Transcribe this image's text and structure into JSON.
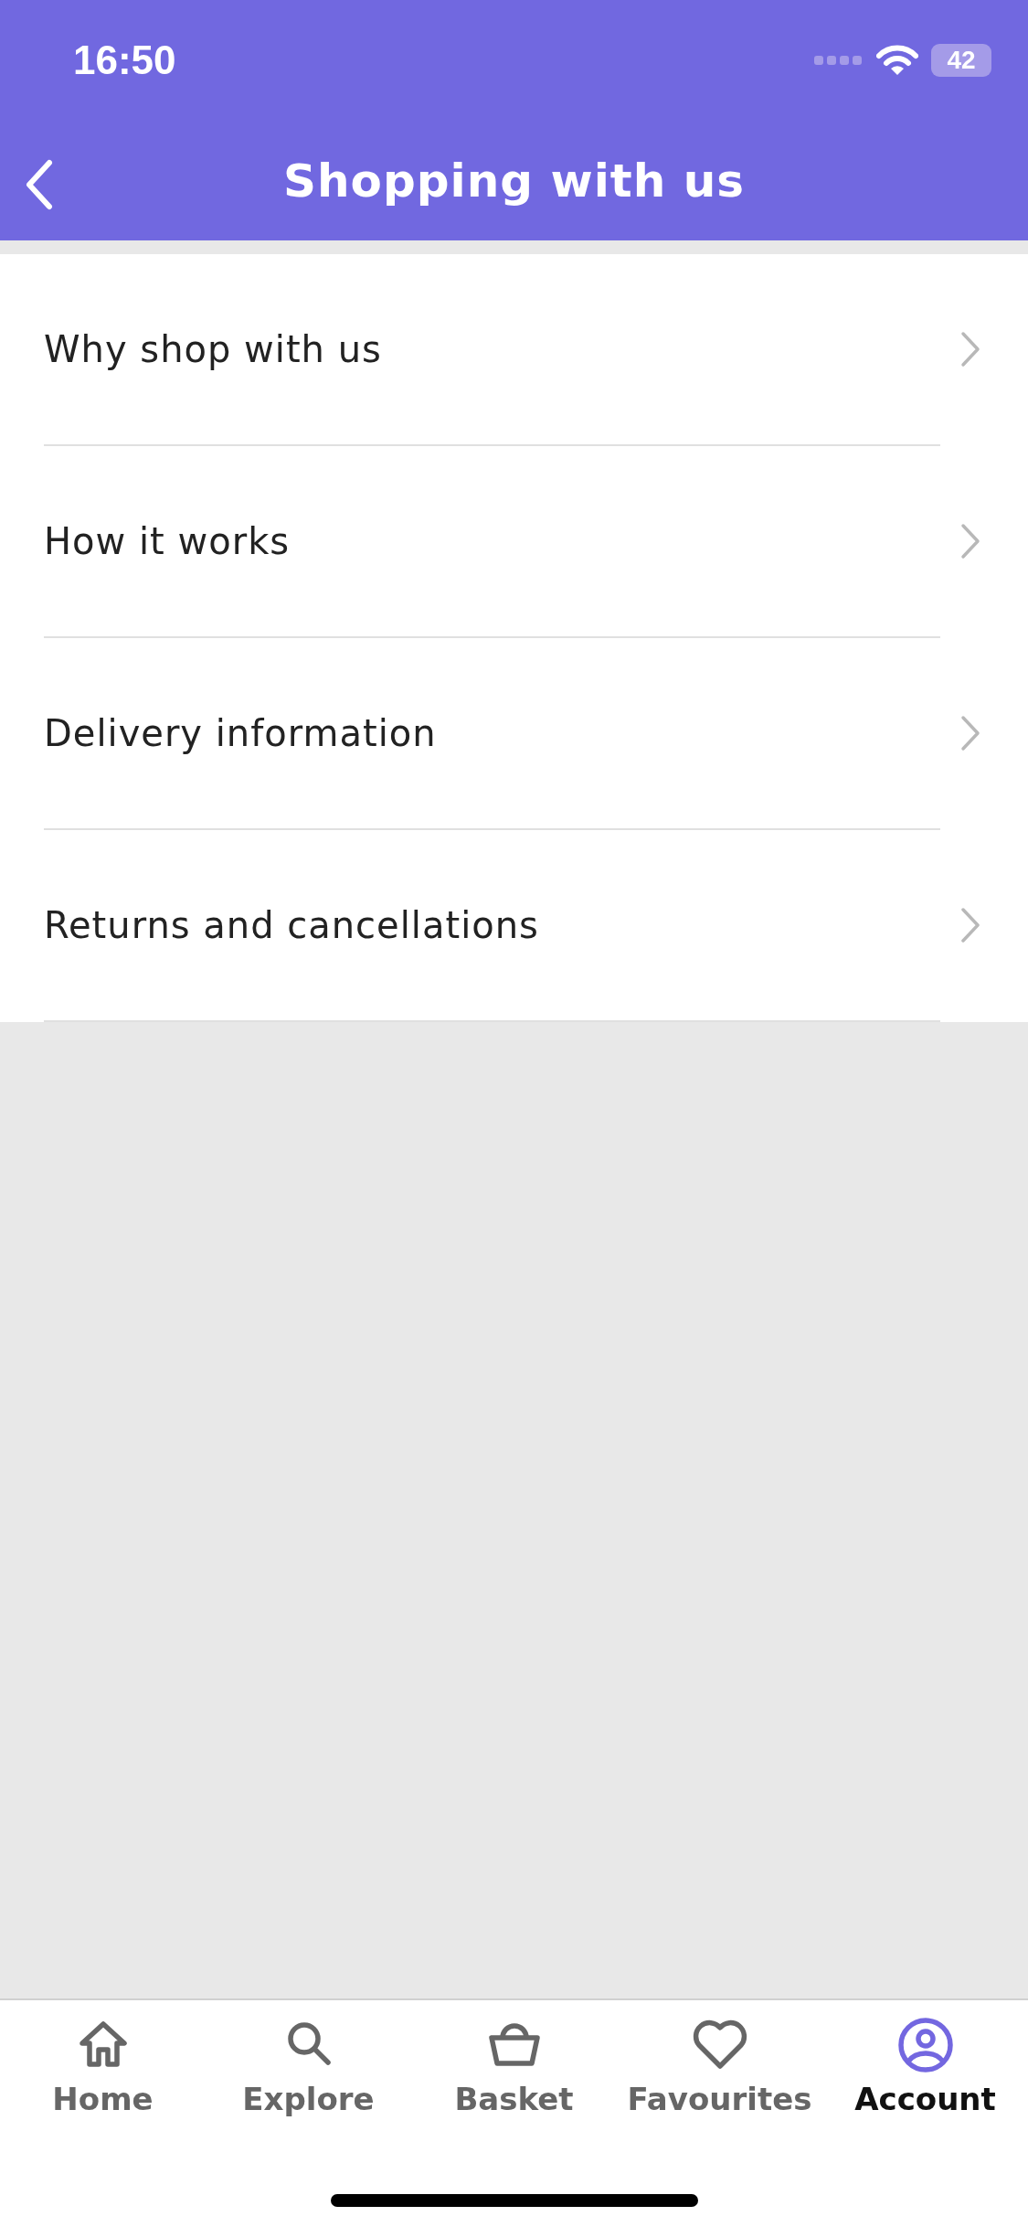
{
  "status_bar": {
    "time": "16:50",
    "battery": "42"
  },
  "header": {
    "title": "Shopping with us"
  },
  "menu_items": [
    {
      "label": "Why shop with us"
    },
    {
      "label": "How it works"
    },
    {
      "label": "Delivery information"
    },
    {
      "label": "Returns and cancellations"
    }
  ],
  "tab_bar": [
    {
      "kind": "home",
      "label": "Home",
      "selected": false
    },
    {
      "kind": "explore",
      "label": "Explore",
      "selected": false
    },
    {
      "kind": "basket",
      "label": "Basket",
      "selected": false
    },
    {
      "kind": "favourites",
      "label": "Favourites",
      "selected": false
    },
    {
      "kind": "account",
      "label": "Account",
      "selected": true
    }
  ]
}
